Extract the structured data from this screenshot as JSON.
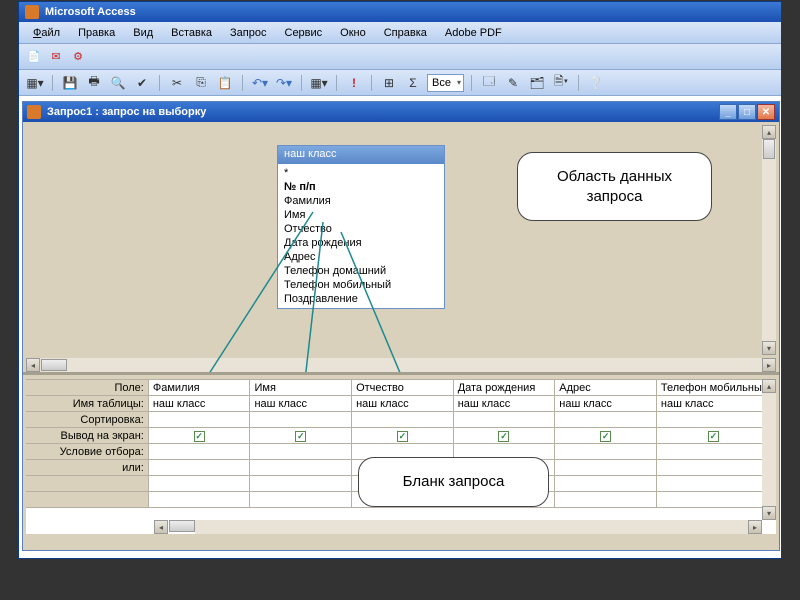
{
  "app": {
    "title": "Microsoft Access"
  },
  "menu": {
    "file": "Файл",
    "edit": "Правка",
    "view": "Вид",
    "insert": "Вставка",
    "query": "Запрос",
    "tools": "Сервис",
    "window": "Окно",
    "help": "Справка",
    "adobe": "Adobe PDF"
  },
  "toolbar": {
    "combo_value": "Все"
  },
  "query_window": {
    "title": "Запрос1 : запрос на выборку"
  },
  "table_box": {
    "title": "наш класс",
    "fields": [
      "*",
      "№ п/п",
      "Фамилия",
      "Имя",
      "Отчество",
      "Дата рождения",
      "Адрес",
      "Телефон домашний",
      "Телефон мобильный",
      "Поздравление"
    ]
  },
  "callouts": {
    "data_area": "Область данных запроса",
    "blank": "Бланк запроса"
  },
  "grid": {
    "row_labels": {
      "field": "Поле:",
      "table": "Имя таблицы:",
      "sort": "Сортировка:",
      "show": "Вывод на экран:",
      "criteria": "Условие отбора:",
      "or": "или:"
    },
    "columns": [
      {
        "field": "Фамилия",
        "table": "наш класс",
        "show": true
      },
      {
        "field": "Имя",
        "table": "наш класс",
        "show": true
      },
      {
        "field": "Отчество",
        "table": "наш класс",
        "show": true
      },
      {
        "field": "Дата рождения",
        "table": "наш класс",
        "show": true
      },
      {
        "field": "Адрес",
        "table": "наш класс",
        "show": true
      },
      {
        "field": "Телефон мобильны",
        "table": "наш класс",
        "show": true
      }
    ]
  }
}
